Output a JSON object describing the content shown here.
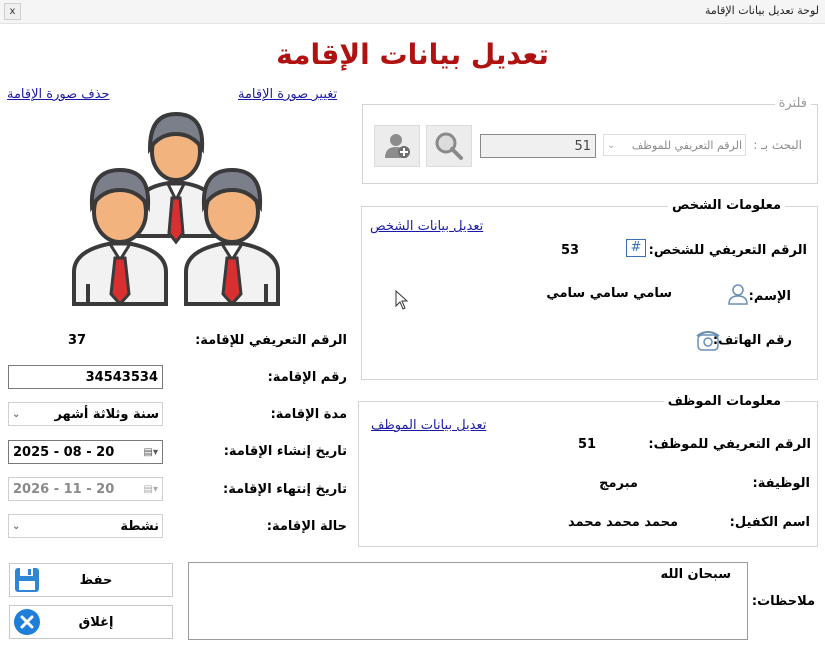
{
  "window": {
    "title": "لوحة تعديل بيانات الإقامة",
    "close_glyph": "x"
  },
  "heading": "تعديل بيانات الإقامة",
  "photo": {
    "change_link": "تغيير صورة الإقامة",
    "delete_link": "حذف صورة الإقامة",
    "image_icon": "people-group-icon"
  },
  "filter": {
    "legend": "فلترة",
    "search_by_label": "البحث بـ :",
    "search_by_value": "الرقم التعريفي للموظف",
    "search_value": "51",
    "search_icon": "magnifier-icon",
    "add_icon": "add-person-icon"
  },
  "person": {
    "legend": "معلومات الشخص",
    "edit_link": "تعديل بيانات الشخص",
    "id_label": "الرقم التعريفي للشخص:",
    "id_value": "53",
    "name_label": "الإسم:",
    "name_value": "سامي سامي  سامي",
    "phone_label": "رقم الهاتف:",
    "phone_value": ""
  },
  "employee": {
    "legend": "معلومات الموظف",
    "edit_link": "تعديل بيانات الموظف",
    "id_label": "الرقم التعريفي للموظف:",
    "id_value": "51",
    "job_label": "الوظيفة:",
    "job_value": "مبرمج",
    "sponsor_label": "اسم الكفيل:",
    "sponsor_value": "محمد محمد  محمد"
  },
  "residence": {
    "id_label": "الرقم التعريفي للإقامة:",
    "id_value": "37",
    "number_label": "رقم الإقامة:",
    "number_value": "34543534",
    "duration_label": "مدة الإقامة:",
    "duration_value": "سنة وثلاثة أشهر",
    "created_label": "تاريخ إنشاء الإقامة:",
    "created_value": "2025 - 08 - 20",
    "expiry_label": "تاريخ إنتهاء الإقامة:",
    "expiry_value": "2026 - 11 - 20",
    "status_label": "حالة الإقامة:",
    "status_value": "نشطة"
  },
  "notes": {
    "label": "ملاحظات:",
    "value": "سبحان الله"
  },
  "buttons": {
    "save": "حفظ",
    "close": "إغلاق"
  },
  "colors": {
    "heading": "#b01212",
    "link": "#1a1aa6",
    "save_icon": "#2f86d6",
    "close_icon": "#1f7fd8"
  }
}
